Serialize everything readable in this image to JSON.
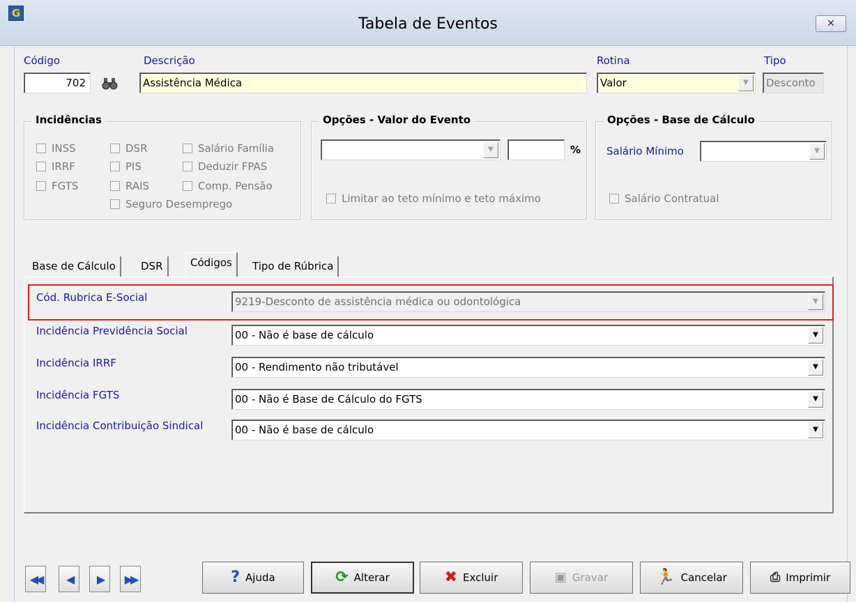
{
  "window": {
    "title": "Tabela de Eventos",
    "app_icon": "G",
    "close": "✕"
  },
  "header": {
    "codigo_label": "Código",
    "codigo_value": "702",
    "descricao_label": "Descrição",
    "descricao_value": "Assistência Médica",
    "rotina_label": "Rotina",
    "rotina_value": "Valor",
    "tipo_label": "Tipo",
    "tipo_value": "Desconto"
  },
  "incidencias": {
    "title": "Incidências",
    "items": [
      "INSS",
      "DSR",
      "Salário Família",
      "IRRF",
      "PIS",
      "Deduzir FPAS",
      "FGTS",
      "RAIS",
      "Comp. Pensão",
      "Seguro Desemprego"
    ]
  },
  "opcoes_valor": {
    "title": "Opções - Valor do Evento",
    "percent_symbol": "%",
    "limitar_label": "Limitar ao teto mínimo e teto máximo"
  },
  "opcoes_base": {
    "title": "Opções - Base de Cálculo",
    "salario_minimo_label": "Salário Mínimo",
    "salario_contratual_label": "Salário Contratual"
  },
  "tabs": [
    {
      "label": "Base de Cálculo"
    },
    {
      "label": "DSR"
    },
    {
      "label": "Códigos",
      "active": true
    },
    {
      "label": "Tipo de Rúbrica"
    }
  ],
  "codigos": {
    "rows": [
      {
        "label": "Cód. Rubrica E-Social",
        "value": "9219-Desconto de assistência médica ou odontológica"
      },
      {
        "label": "Incidência Previdência Social",
        "value": "00 - Não é base de cálculo"
      },
      {
        "label": "Incidência IRRF",
        "value": "00 - Rendimento não tributável"
      },
      {
        "label": "Incidência FGTS",
        "value": "00 - Não é Base de Cálculo do FGTS"
      },
      {
        "label": "Incidência Contribuição Sindical",
        "value": "00 - Não é base de cálculo"
      }
    ],
    "highlight_color": "#e0201c"
  },
  "buttons": {
    "ajuda": "Ajuda",
    "alterar": "Alterar",
    "excluir": "Excluir",
    "gravar": "Gravar",
    "cancelar": "Cancelar",
    "imprimir": "Imprimir"
  },
  "icons": {
    "search": "binoculars-icon",
    "help": "question-icon",
    "refresh": "refresh-icon",
    "delete": "x-icon",
    "save": "floppy-icon",
    "cancel": "running-man-icon",
    "print": "printer-icon"
  }
}
